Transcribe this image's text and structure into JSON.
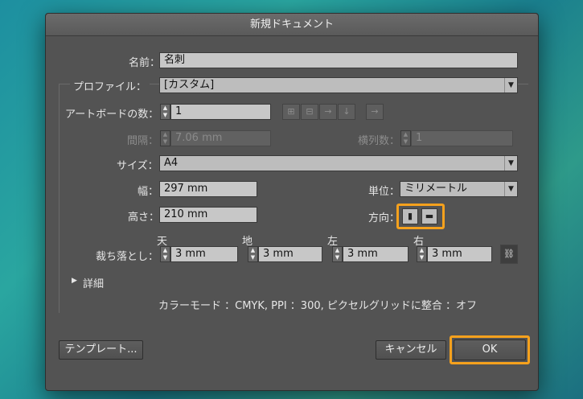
{
  "dialog": {
    "title": "新規ドキュメント",
    "name_label": "名前：",
    "name_value": "名刺",
    "profile_label": "プロファイル：",
    "profile_value": "[カスタム]",
    "artboards_label": "アートボードの数：",
    "artboards_value": "1",
    "spacing_label": "間隔：",
    "spacing_value": "7.06 mm",
    "columns_label": "横列数：",
    "columns_value": "1",
    "size_label": "サイズ：",
    "size_value": "A4",
    "width_label": "幅：",
    "width_value": "297 mm",
    "units_label": "単位：",
    "units_value": "ミリメートル",
    "height_label": "高さ：",
    "height_value": "210 mm",
    "orientation_label": "方向：",
    "bleed_label": "裁ち落とし：",
    "bleed": [
      {
        "label": "天",
        "value": "3 mm"
      },
      {
        "label": "地",
        "value": "3 mm"
      },
      {
        "label": "左",
        "value": "3 mm"
      },
      {
        "label": "右",
        "value": "3 mm"
      }
    ],
    "advanced_label": "詳細",
    "summary": "カラーモード ：CMYK, PPI ：300, ピクセルグリッドに整合 ：オフ",
    "templates_button": "テンプレート...",
    "cancel_button": "キャンセル",
    "ok_button": "OK"
  },
  "icons": {
    "stepper": "up-down-arrows",
    "arrange_grid_row": "grid-by-row-icon",
    "arrange_grid_col": "grid-by-column-icon",
    "arrange_row": "arrange-by-row-icon",
    "arrange_col": "arrange-by-column-icon",
    "layout_direction": "right-to-left-icon",
    "orientation_portrait": "portrait-icon",
    "orientation_landscape": "landscape-icon",
    "link_bleed": "link-chain-icon",
    "disclosure": "disclosure-triangle-icon",
    "dropdown": "dropdown-arrow-icon"
  },
  "colors": {
    "highlight": "#f5a11d",
    "dialog_bg": "#535353"
  }
}
